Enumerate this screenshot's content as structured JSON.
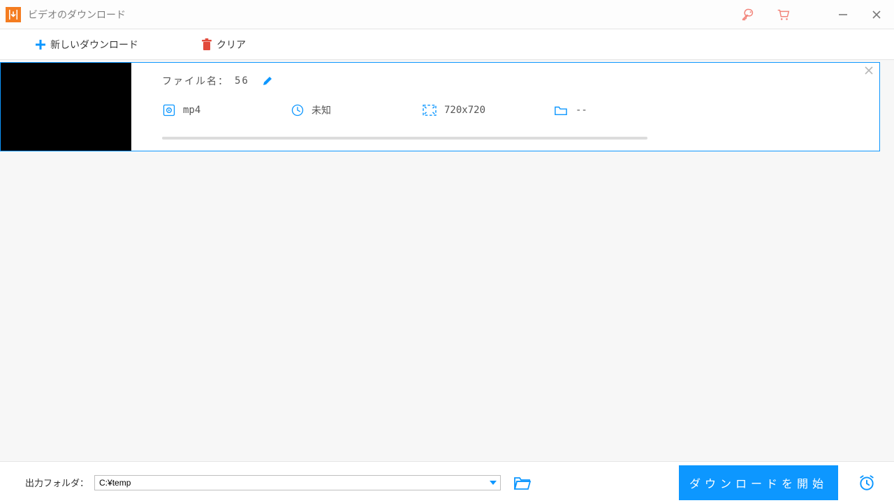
{
  "titlebar": {
    "title": "ビデオのダウンロード"
  },
  "toolbar": {
    "new_download": "新しいダウンロード",
    "clear": "クリア"
  },
  "item": {
    "filename_label": "ファイル名：",
    "filename_value": "56",
    "format": "mp4",
    "duration": "未知",
    "resolution": "720x720",
    "size": "--"
  },
  "footer": {
    "folder_label": "出力フォルダ：",
    "folder_path": "C:¥temp",
    "download_button": "ダウンロードを開始"
  },
  "colors": {
    "accent": "#0d97ff",
    "orange": "#f47c20",
    "salmon": "#f2847a",
    "trash": "#e24a3b"
  }
}
